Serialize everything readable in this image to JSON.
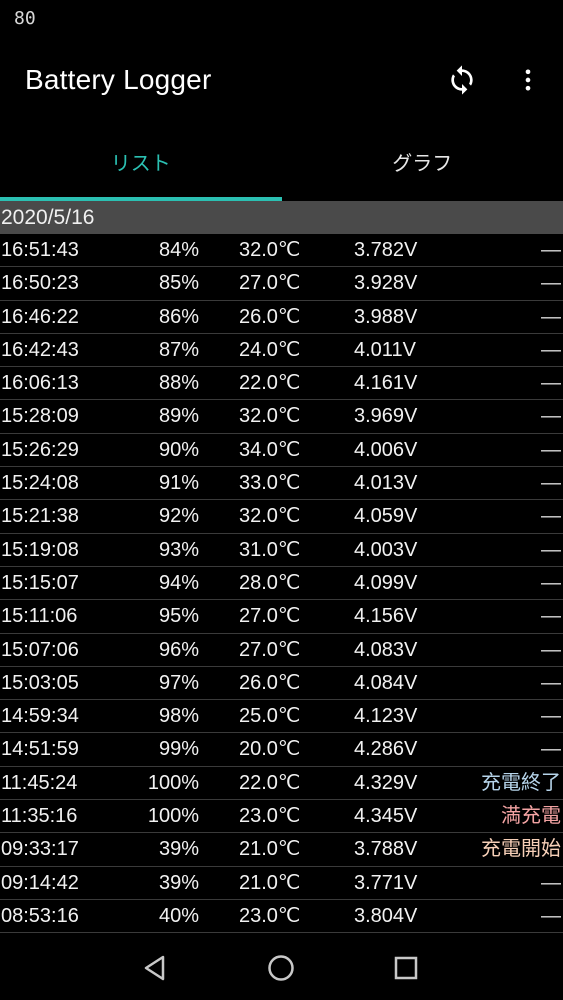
{
  "status_bar": {
    "clock": "80"
  },
  "app_bar": {
    "title": "Battery Logger",
    "sync_icon": "sync-icon",
    "menu_icon": "more-vert-icon"
  },
  "tabs": [
    {
      "label": "リスト",
      "active": true
    },
    {
      "label": "グラフ",
      "active": false
    }
  ],
  "log": {
    "date": "2020/5/16",
    "rows": [
      {
        "time": "16:51:43",
        "level": "84%",
        "temp": "32.0℃",
        "volt": "3.782V",
        "status": "—"
      },
      {
        "time": "16:50:23",
        "level": "85%",
        "temp": "27.0℃",
        "volt": "3.928V",
        "status": "—"
      },
      {
        "time": "16:46:22",
        "level": "86%",
        "temp": "26.0℃",
        "volt": "3.988V",
        "status": "—"
      },
      {
        "time": "16:42:43",
        "level": "87%",
        "temp": "24.0℃",
        "volt": "4.011V",
        "status": "—"
      },
      {
        "time": "16:06:13",
        "level": "88%",
        "temp": "22.0℃",
        "volt": "4.161V",
        "status": "—"
      },
      {
        "time": "15:28:09",
        "level": "89%",
        "temp": "32.0℃",
        "volt": "3.969V",
        "status": "—"
      },
      {
        "time": "15:26:29",
        "level": "90%",
        "temp": "34.0℃",
        "volt": "4.006V",
        "status": "—"
      },
      {
        "time": "15:24:08",
        "level": "91%",
        "temp": "33.0℃",
        "volt": "4.013V",
        "status": "—"
      },
      {
        "time": "15:21:38",
        "level": "92%",
        "temp": "32.0℃",
        "volt": "4.059V",
        "status": "—"
      },
      {
        "time": "15:19:08",
        "level": "93%",
        "temp": "31.0℃",
        "volt": "4.003V",
        "status": "—"
      },
      {
        "time": "15:15:07",
        "level": "94%",
        "temp": "28.0℃",
        "volt": "4.099V",
        "status": "—"
      },
      {
        "time": "15:11:06",
        "level": "95%",
        "temp": "27.0℃",
        "volt": "4.156V",
        "status": "—"
      },
      {
        "time": "15:07:06",
        "level": "96%",
        "temp": "27.0℃",
        "volt": "4.083V",
        "status": "—"
      },
      {
        "time": "15:03:05",
        "level": "97%",
        "temp": "26.0℃",
        "volt": "4.084V",
        "status": "—"
      },
      {
        "time": "14:59:34",
        "level": "98%",
        "temp": "25.0℃",
        "volt": "4.123V",
        "status": "—"
      },
      {
        "time": "14:51:59",
        "level": "99%",
        "temp": "20.0℃",
        "volt": "4.286V",
        "status": "—"
      },
      {
        "time": "11:45:24",
        "level": "100%",
        "temp": "22.0℃",
        "volt": "4.329V",
        "status": "充電終了"
      },
      {
        "time": "11:35:16",
        "level": "100%",
        "temp": "23.0℃",
        "volt": "4.345V",
        "status": "満充電"
      },
      {
        "time": "09:33:17",
        "level": "39%",
        "temp": "21.0℃",
        "volt": "3.788V",
        "status": "充電開始"
      },
      {
        "time": "09:14:42",
        "level": "39%",
        "temp": "21.0℃",
        "volt": "3.771V",
        "status": "—"
      },
      {
        "time": "08:53:16",
        "level": "40%",
        "temp": "23.0℃",
        "volt": "3.804V",
        "status": "—"
      }
    ]
  },
  "nav_bar": {
    "back_icon": "back-triangle-icon",
    "home_icon": "home-circle-icon",
    "recent_icon": "recents-square-icon"
  },
  "colors": {
    "accent": "#2bc0b2",
    "date_header_bg": "#4a4a4a",
    "status_charge_end": "#b6d4ea",
    "status_full": "#f3a3a3",
    "status_charge_start": "#f7d0b8"
  }
}
